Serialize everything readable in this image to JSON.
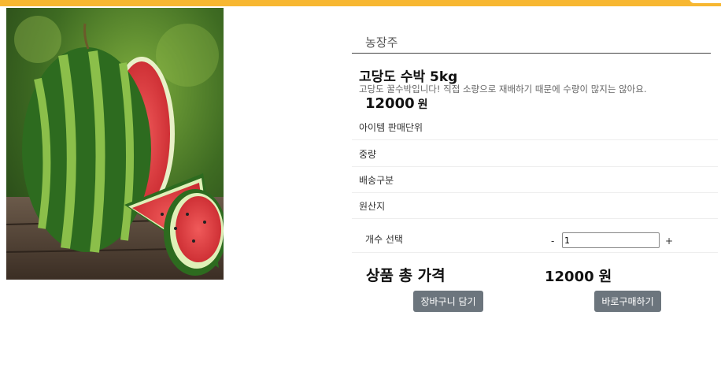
{
  "colors": {
    "accent": "#f7b731",
    "button": "#6c757d"
  },
  "product": {
    "image_alt": "watermelon",
    "farmer": "농장주",
    "title": "고당도 수박 5kg",
    "description": "고당도 꿀수박입니다! 직접 소량으로 재배하기 때문에 수량이 많지는 않아요.",
    "price": "12000",
    "currency": "원"
  },
  "info_rows": [
    "아이템 판매단위",
    "중량",
    "배송구분",
    "원산지"
  ],
  "quantity": {
    "label": "개수 선택",
    "minus": "-",
    "value": "1",
    "plus": "+"
  },
  "total": {
    "label": "상품 총 가격",
    "value": "12000",
    "currency": "원"
  },
  "buttons": {
    "cart": "장바구니 담기",
    "buy": "바로구매하기"
  }
}
